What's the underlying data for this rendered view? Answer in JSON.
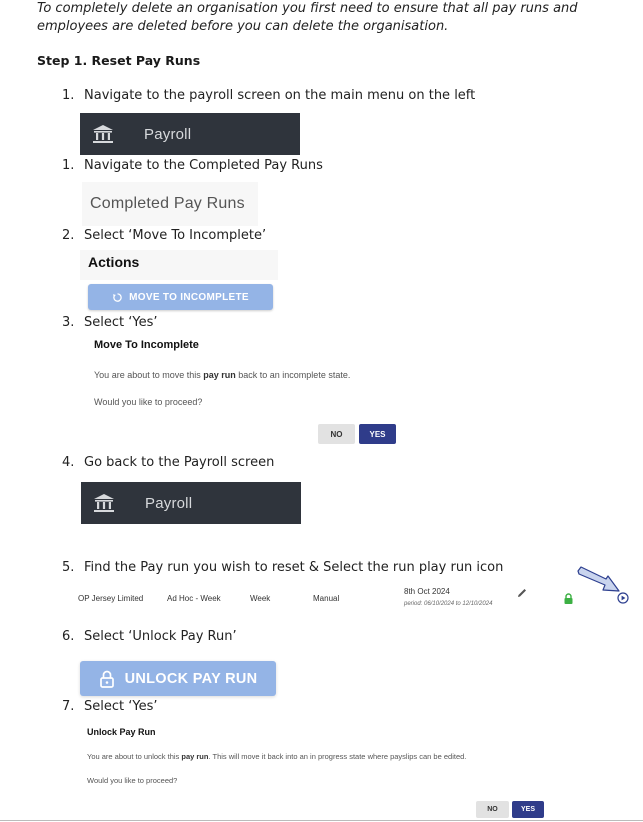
{
  "intro": "To completely delete an organisation you first need to ensure that all pay runs and employees are deleted before you can delete the organisation.",
  "step_heading": "Step 1. Reset Pay Runs",
  "steps": [
    {
      "num": "1.",
      "text": "Navigate to the payroll screen on the main menu on the left"
    },
    {
      "num": "1.",
      "text": "Navigate to the Completed Pay Runs"
    },
    {
      "num": "2.",
      "text": "Select ‘Move To Incomplete’"
    },
    {
      "num": "3.",
      "text": "Select ‘Yes’"
    },
    {
      "num": "4.",
      "text": "Go back to the Payroll screen"
    },
    {
      "num": "5.",
      "text": "Find the Pay run you wish to reset & Select the run play run icon"
    },
    {
      "num": "6.",
      "text": "Select ‘Unlock Pay Run’"
    },
    {
      "num": "7.",
      "text": "Select ‘Yes’"
    }
  ],
  "payroll_label": "Payroll",
  "completed_pay_runs_label": "Completed Pay Runs",
  "actions_label": "Actions",
  "move_to_incomplete_button": "MOVE TO INCOMPLETE",
  "move_dialog": {
    "title": "Move To Incomplete",
    "text_pre": "You are about to move this ",
    "text_bold": "pay run",
    "text_post": " back to an incomplete state.",
    "question": "Would you like to proceed?",
    "no": "NO",
    "yes": "YES"
  },
  "pay_run_row": {
    "company": "OP Jersey Limited",
    "type": "Ad Hoc - Week",
    "frequency": "Week",
    "mode": "Manual",
    "date": "8th Oct 2024",
    "period": "period: 06/10/2024 to 12/10/2024"
  },
  "unlock_button": "UNLOCK PAY RUN",
  "unlock_dialog": {
    "title": "Unlock Pay Run",
    "text_pre": "You are about to unlock this ",
    "text_bold": "pay run",
    "text_post": ". This will move it back into an in progress state where payslips can be edited.",
    "question": "Would you like to proceed?",
    "no": "NO",
    "yes": "YES"
  },
  "colors": {
    "payroll_bar": "#2f343c",
    "button_blue": "#94b4e6",
    "yes_button": "#2f3c8a",
    "lock_green": "#3cb043",
    "arrow_fill": "#c9d4ee",
    "arrow_stroke": "#2d3f8f"
  },
  "icons": [
    "bank-icon",
    "refresh-icon",
    "edit-pencil-icon",
    "lock-icon",
    "play-circle-icon",
    "arrow-icon",
    "unlock-icon"
  ]
}
